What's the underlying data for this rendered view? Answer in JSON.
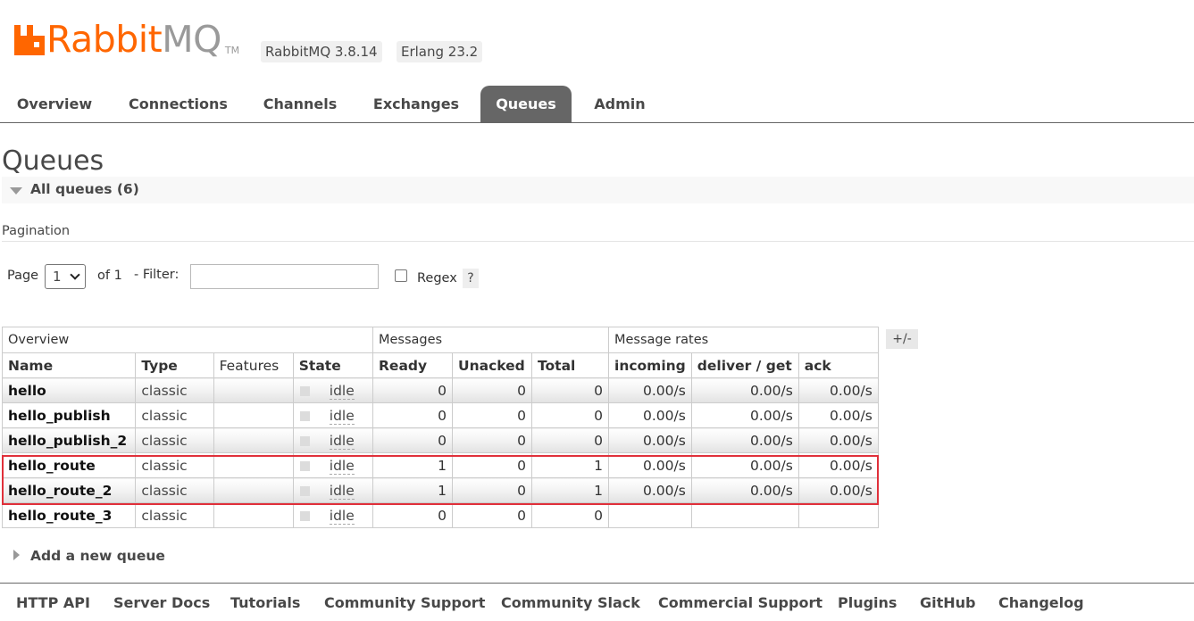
{
  "header": {
    "logo_word_a": "Rabbit",
    "logo_word_b": "MQ",
    "logo_tm": "TM",
    "version": "RabbitMQ 3.8.14",
    "erlang": "Erlang 23.2"
  },
  "tabs": [
    {
      "label": "Overview"
    },
    {
      "label": "Connections"
    },
    {
      "label": "Channels"
    },
    {
      "label": "Exchanges"
    },
    {
      "label": "Queues",
      "active": true
    },
    {
      "label": "Admin"
    }
  ],
  "page_title": "Queues",
  "section_title": "All queues (6)",
  "pagination": {
    "title": "Pagination",
    "page_label": "Page",
    "page_value": "1",
    "of_label": "of 1",
    "filter_label": "- Filter:",
    "filter_value": "",
    "regex_label": "Regex",
    "help": "?"
  },
  "table": {
    "groups": [
      "Overview",
      "Messages",
      "Message rates"
    ],
    "columns": [
      "Name",
      "Type",
      "Features",
      "State",
      "Ready",
      "Unacked",
      "Total",
      "incoming",
      "deliver / get",
      "ack"
    ],
    "toggle_label": "+/-",
    "rows": [
      {
        "name": "hello",
        "type": "classic",
        "features": "",
        "state": "idle",
        "ready": "0",
        "unacked": "0",
        "total": "0",
        "incoming": "0.00/s",
        "deliver": "0.00/s",
        "ack": "0.00/s"
      },
      {
        "name": "hello_publish",
        "type": "classic",
        "features": "",
        "state": "idle",
        "ready": "0",
        "unacked": "0",
        "total": "0",
        "incoming": "0.00/s",
        "deliver": "0.00/s",
        "ack": "0.00/s"
      },
      {
        "name": "hello_publish_2",
        "type": "classic",
        "features": "",
        "state": "idle",
        "ready": "0",
        "unacked": "0",
        "total": "0",
        "incoming": "0.00/s",
        "deliver": "0.00/s",
        "ack": "0.00/s"
      },
      {
        "name": "hello_route",
        "type": "classic",
        "features": "",
        "state": "idle",
        "ready": "1",
        "unacked": "0",
        "total": "1",
        "incoming": "0.00/s",
        "deliver": "0.00/s",
        "ack": "0.00/s"
      },
      {
        "name": "hello_route_2",
        "type": "classic",
        "features": "",
        "state": "idle",
        "ready": "1",
        "unacked": "0",
        "total": "1",
        "incoming": "0.00/s",
        "deliver": "0.00/s",
        "ack": "0.00/s"
      },
      {
        "name": "hello_route_3",
        "type": "classic",
        "features": "",
        "state": "idle",
        "ready": "0",
        "unacked": "0",
        "total": "0",
        "incoming": "",
        "deliver": "",
        "ack": ""
      }
    ]
  },
  "add_queue_label": "Add a new queue",
  "footer": [
    "HTTP API",
    "Server Docs",
    "Tutorials",
    "Community Support",
    "Community Slack",
    "Commercial Support",
    "Plugins",
    "GitHub",
    "Changelog"
  ],
  "colors": {
    "brand": "#ff6600",
    "highlight": "#e0303a",
    "tab_active": "#666666"
  }
}
